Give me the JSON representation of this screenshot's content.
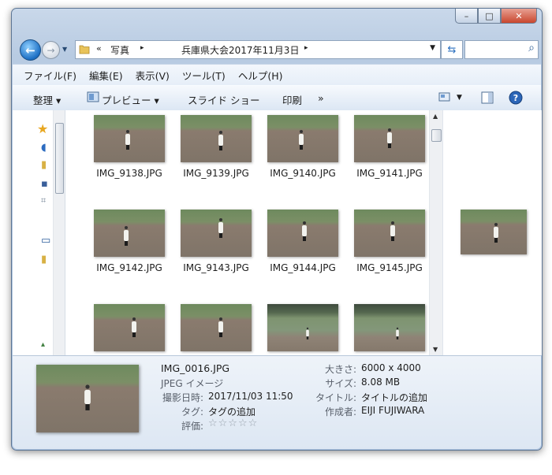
{
  "window": {
    "controls": {
      "minimize": "–",
      "maximize": "□",
      "close": "✕"
    }
  },
  "nav": {
    "breadcrumb_prefix": "«",
    "crumb1": "写真",
    "crumb2": "兵庫県大会2017年11月3日",
    "arrow": "▸",
    "search_placeholder": "",
    "icons": [
      "back-icon",
      "forward-icon",
      "folder-icon",
      "refresh-icon",
      "search-icon"
    ]
  },
  "menu": [
    "ファイル(F)",
    "編集(E)",
    "表示(V)",
    "ツール(T)",
    "ヘルプ(H)"
  ],
  "toolbar": {
    "organize": "整理 ▾",
    "preview": "プレビュー ▾",
    "slideshow": "スライド ショー",
    "print": "印刷",
    "more": "»"
  },
  "files": [
    "IMG_9138.JPG",
    "IMG_9139.JPG",
    "IMG_9140.JPG",
    "IMG_9141.JPG",
    "IMG_9142.JPG",
    "IMG_9143.JPG",
    "IMG_9144.JPG",
    "IMG_9145.JPG",
    "",
    "",
    "",
    ""
  ],
  "details": {
    "filename": "IMG_0016.JPG",
    "filetype": "JPEG イメージ",
    "date_label": "撮影日時:",
    "date_value": "2017/11/03 11:50",
    "tags_label": "タグ:",
    "tags_value": "タグの追加",
    "rating_label": "評価:",
    "rating_stars": "☆☆☆☆☆",
    "size_label": "大きさ:",
    "size_value": "6000 x 4000",
    "filesize_label": "サイズ:",
    "filesize_value": "8.08 MB",
    "title_label": "タイトル:",
    "title_value": "タイトルの追加",
    "author_label": "作成者:",
    "author_value": "EIJI FUJIWARA"
  }
}
